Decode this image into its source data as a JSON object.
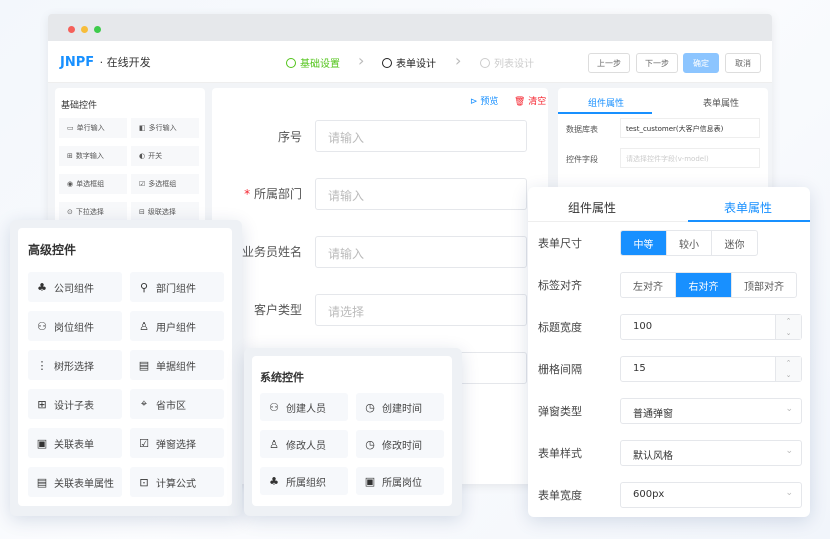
{
  "header": {
    "logo": "JNPF",
    "subtitle": "· 在线开发",
    "steps": [
      {
        "label": "基础设置",
        "state": "done"
      },
      {
        "label": "表单设计",
        "state": "active"
      },
      {
        "label": "列表设计",
        "state": "pending"
      }
    ],
    "buttons": {
      "prev": "上一步",
      "next": "下一步",
      "confirm": "确定",
      "cancel": "取消"
    }
  },
  "basic": {
    "title": "基础控件",
    "items": [
      "单行输入",
      "多行输入",
      "数字输入",
      "开关",
      "单选框组",
      "多选框组",
      "下拉选择",
      "级联选择"
    ]
  },
  "canvas": {
    "preview": "预览",
    "clear": "清空",
    "rows": [
      {
        "label": "序号",
        "placeholder": "请输入",
        "required": false
      },
      {
        "label": "所属部门",
        "placeholder": "请输入",
        "required": true
      },
      {
        "label": "业务员姓名",
        "placeholder": "请输入",
        "required": false
      },
      {
        "label": "客户类型",
        "placeholder": "请选择",
        "required": false
      }
    ]
  },
  "right_panel": {
    "tabs": [
      "组件属性",
      "表单属性"
    ],
    "db_label": "数据库表",
    "db_value": "test_customer(大客户信息表)",
    "field_label": "控件字段",
    "field_placeholder": "请选择控件字段(v-model)"
  },
  "advanced": {
    "title": "高级控件",
    "items": [
      "公司组件",
      "部门组件",
      "岗位组件",
      "用户组件",
      "树形选择",
      "单据组件",
      "设计子表",
      "省市区",
      "关联表单",
      "弹窗选择",
      "关联表单属性",
      "计算公式"
    ]
  },
  "system": {
    "title": "系统控件",
    "items": [
      "创建人员",
      "创建时间",
      "修改人员",
      "修改时间",
      "所属组织",
      "所属岗位"
    ]
  },
  "form_props": {
    "tabs": [
      "组件属性",
      "表单属性"
    ],
    "active_tab": "表单属性",
    "size": {
      "label": "表单尺寸",
      "options": [
        "中等",
        "较小",
        "迷你"
      ],
      "selected": "中等"
    },
    "align": {
      "label": "标签对齐",
      "options": [
        "左对齐",
        "右对齐",
        "顶部对齐"
      ],
      "selected": "右对齐"
    },
    "label_width": {
      "label": "标题宽度",
      "value": "100"
    },
    "gutter": {
      "label": "栅格间隔",
      "value": "15"
    },
    "popup": {
      "label": "弹窗类型",
      "value": "普通弹窗"
    },
    "style": {
      "label": "表单样式",
      "value": "默认风格"
    },
    "width": {
      "label": "表单宽度",
      "value": "600px"
    }
  },
  "colors": {
    "primary": "#1890ff",
    "success": "#52c41a",
    "danger": "#f5222d"
  }
}
